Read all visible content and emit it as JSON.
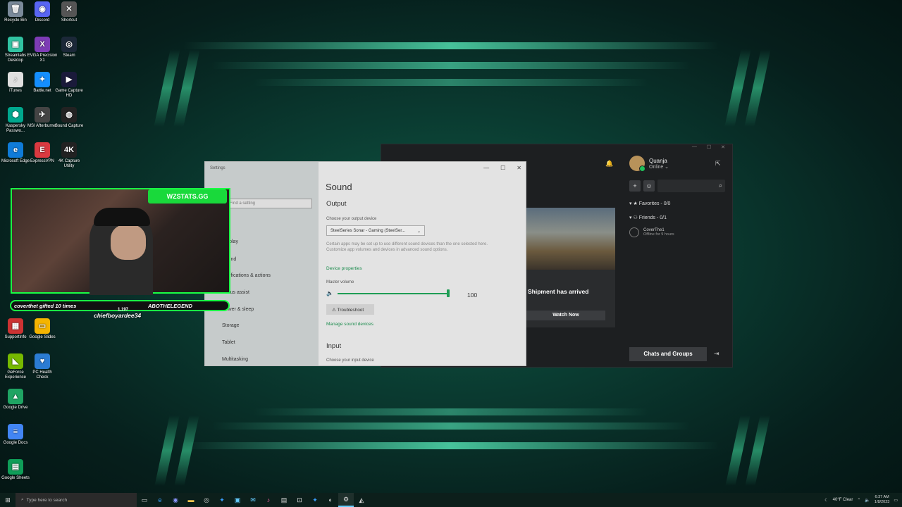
{
  "desktop_icons": [
    {
      "label": "Recycle Bin",
      "icon": "recycle-bin-icon",
      "glyph": "🗑",
      "color": "#7a8a9a"
    },
    {
      "label": "Discord",
      "icon": "discord-icon",
      "glyph": "◉",
      "color": "#5865f2"
    },
    {
      "label": "Shortcut",
      "icon": "shortcut-icon",
      "glyph": "✕",
      "color": "#555"
    },
    {
      "label": "Streamlabs Desktop",
      "icon": "streamlabs-icon",
      "glyph": "▣",
      "color": "#31c3a2"
    },
    {
      "label": "EVGA Precision X1",
      "icon": "evga-icon",
      "glyph": "X",
      "color": "#7d3cb5"
    },
    {
      "label": "Steam",
      "icon": "steam-icon",
      "glyph": "◎",
      "color": "#1b2838"
    },
    {
      "label": "iTunes",
      "icon": "itunes-icon",
      "glyph": "♪",
      "color": "#e0e0e0"
    },
    {
      "label": "Battle.net",
      "icon": "battlenet-icon",
      "glyph": "✦",
      "color": "#148eff"
    },
    {
      "label": "Game Capture HD",
      "icon": "game-capture-icon",
      "glyph": "▶",
      "color": "#1a1a3a"
    },
    {
      "label": "Kaspersky Passwo...",
      "icon": "kaspersky-icon",
      "glyph": "⬢",
      "color": "#00a88e"
    },
    {
      "label": "MSI Afterburner",
      "icon": "msi-afterburner-icon",
      "glyph": "✈",
      "color": "#444"
    },
    {
      "label": "Sound Capture",
      "icon": "sound-capture-icon",
      "glyph": "◍",
      "color": "#222"
    },
    {
      "label": "Microsoft Edge",
      "icon": "edge-icon",
      "glyph": "e",
      "color": "#0f7bd8"
    },
    {
      "label": "ExpressVPN",
      "icon": "expressvpn-icon",
      "glyph": "E",
      "color": "#da3940"
    },
    {
      "label": "4K Capture Utility",
      "icon": "4k-capture-icon",
      "glyph": "4K",
      "color": "#222"
    },
    {
      "label": "SupportInfo",
      "icon": "supportinfo-icon",
      "glyph": "▦",
      "color": "#c33"
    },
    {
      "label": "Google Slides",
      "icon": "google-slides-icon",
      "glyph": "▭",
      "color": "#f4b400"
    },
    {
      "label": "GeForce Experience",
      "icon": "geforce-icon",
      "glyph": "◣",
      "color": "#76b900"
    },
    {
      "label": "PC Health Check",
      "icon": "pc-health-icon",
      "glyph": "♥",
      "color": "#2b7cd3"
    },
    {
      "label": "Google Drive",
      "icon": "google-drive-icon",
      "glyph": "▲",
      "color": "#1fa463"
    },
    {
      "label": "Google Docs",
      "icon": "google-docs-icon",
      "glyph": "≡",
      "color": "#4285f4"
    },
    {
      "label": "Google Sheets",
      "icon": "google-sheets-icon",
      "glyph": "▤",
      "color": "#0f9d58"
    }
  ],
  "xbox_app": {
    "profile_name": "Quanja",
    "profile_status": "Online ⌄",
    "favorites": "Favorites - 0/0",
    "friends": "Friends - 0/1",
    "friend_name": "CoverThe1",
    "friend_status": "Offline for 9 hours",
    "card_text": "Shipment has arrived",
    "watch_label": "Watch Now",
    "chats_label": "Chats and Groups"
  },
  "settings": {
    "window_title": "Settings",
    "search_placeholder": "Find a setting",
    "sidebar_items": [
      "Display",
      "Sound",
      "Notifications & actions",
      "Focus assist",
      "Power & sleep",
      "Storage",
      "Tablet",
      "Multitasking"
    ],
    "page_title": "Sound",
    "output_heading": "Output",
    "output_label": "Choose your output device",
    "output_device": "SteelSeries Sonar - Gaming (SteelSer...",
    "info_text": "Certain apps may be set up to use different sound devices than the one selected here. Customize app volumes and devices in advanced sound options.",
    "device_properties": "Device properties",
    "master_volume_label": "Master volume",
    "master_volume_value": "100",
    "troubleshoot_label": "Troubleshoot",
    "manage_devices": "Manage sound devices",
    "input_heading": "Input",
    "input_label": "Choose your input device"
  },
  "stream_overlay": {
    "badge": "WZSTATS.GG",
    "left_text": "coverthet gifted 10 times",
    "count": "1,197",
    "right_text": "ABOTHELEGEND",
    "name": "chiefboyardee34"
  },
  "taskbar": {
    "search_placeholder": "Type here to search",
    "weather": "40°F Clear",
    "time": "6:37 AM",
    "date": "1/8/2023"
  },
  "colors": {
    "accent_green": "#19ff44",
    "settings_link": "#1d8c4e"
  }
}
